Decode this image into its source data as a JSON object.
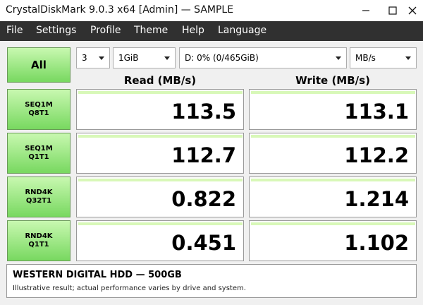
{
  "window": {
    "title": "CrystalDiskMark 9.0.3 x64 [Admin]  —  SAMPLE",
    "controls": {
      "minimize_icon": "minimize-icon",
      "maximize_icon": "maximize-icon",
      "close_icon": "close-icon"
    }
  },
  "menu": {
    "items": [
      {
        "label": "File"
      },
      {
        "label": "Settings"
      },
      {
        "label": "Profile"
      },
      {
        "label": "Theme"
      },
      {
        "label": "Help"
      },
      {
        "label": "Language"
      }
    ]
  },
  "toolbar": {
    "all_label": "All",
    "count_value": "3",
    "size_value": "1GiB",
    "drive_value": "D: 0% (0/465GiB)",
    "unit_value": "MB/s"
  },
  "columns": {
    "read": "Read (MB/s)",
    "write": "Write (MB/s)"
  },
  "tests": [
    {
      "line1": "SEQ1M",
      "line2": "Q8T1",
      "read": "113.5",
      "write": "113.1"
    },
    {
      "line1": "SEQ1M",
      "line2": "Q1T1",
      "read": "112.7",
      "write": "112.2"
    },
    {
      "line1": "RND4K",
      "line2": "Q32T1",
      "read": "0.822",
      "write": "1.214"
    },
    {
      "line1": "RND4K",
      "line2": "Q1T1",
      "read": "0.451",
      "write": "1.102"
    }
  ],
  "footer": {
    "drive_name": "WESTERN DIGITAL HDD — 500GB",
    "note": "Illustrative result; actual performance varies by drive and system."
  },
  "colors": {
    "button_top": "#c8f8b0",
    "button_bottom": "#78d860",
    "menubar": "#303030",
    "result_bar": "#d8f8b8"
  }
}
